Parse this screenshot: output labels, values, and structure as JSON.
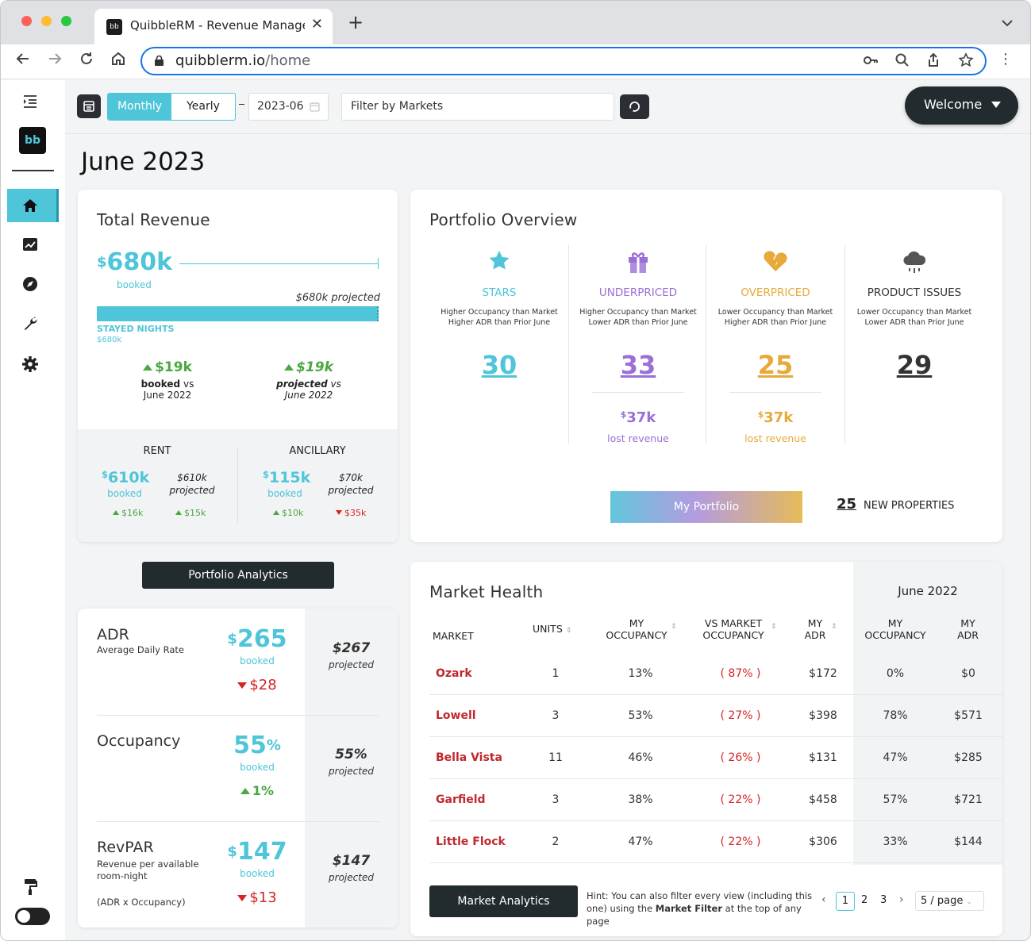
{
  "browser": {
    "tab_title": "QuibbleRM - Revenue Manager",
    "favicon_text": "bb",
    "url_domain": "quibblerm.io",
    "url_path": "/home"
  },
  "topbar": {
    "period_options": [
      "Monthly",
      "Yearly"
    ],
    "selected_period": "Monthly",
    "date_value": "2023-06",
    "market_filter_placeholder": "Filter by Markets",
    "welcome_label": "Welcome"
  },
  "page_title": "June 2023",
  "total_revenue": {
    "title": "Total Revenue",
    "booked_value": "680k",
    "booked_label": "booked",
    "projected_label": "$680k projected",
    "stayed_nights_label": "STAYED NIGHTS",
    "stayed_nights_value": "$680k",
    "progress_fraction": 1.0,
    "vs_booked_value": "$19k",
    "vs_booked_bold": "booked",
    "vs_booked_text": "vs",
    "vs_booked_period": "June 2022",
    "vs_projected_value": "$19k",
    "vs_projected_bold": "projected",
    "vs_projected_text": "vs",
    "vs_projected_period": "June 2022",
    "rent": {
      "label": "RENT",
      "booked": "610k",
      "booked_label": "booked",
      "projected": "$610k",
      "projected_label": "projected",
      "delta_booked": "$16k",
      "delta_projected": "$15k"
    },
    "ancillary": {
      "label": "ANCILLARY",
      "booked": "115k",
      "booked_label": "booked",
      "projected": "$70k",
      "projected_label": "projected",
      "delta_booked": "$10k",
      "delta_projected": "$35k"
    }
  },
  "portfolio_analytics_label": "Portfolio Analytics",
  "kpis": [
    {
      "title": "ADR",
      "subtitle": "Average Daily Rate",
      "extra": "",
      "value": "265",
      "prefix": "$",
      "suffix": "",
      "booked_label": "booked",
      "delta": "$28",
      "direction": "down",
      "projected": "$267",
      "projected_label": "projected"
    },
    {
      "title": "Occupancy",
      "subtitle": "",
      "extra": "",
      "value": "55",
      "prefix": "",
      "suffix": "%",
      "booked_label": "booked",
      "delta": "1%",
      "direction": "up",
      "projected": "55%",
      "projected_label": "projected"
    },
    {
      "title": "RevPAR",
      "subtitle": "Revenue per available room-night",
      "extra": "(ADR x Occupancy)",
      "value": "147",
      "prefix": "$",
      "suffix": "",
      "booked_label": "booked",
      "delta": "$13",
      "direction": "down",
      "projected": "$147",
      "projected_label": "projected"
    }
  ],
  "portfolio_overview": {
    "title": "Portfolio Overview",
    "segments": [
      {
        "key": "stars",
        "label": "STARS",
        "line1": "Higher Occupancy than Market",
        "line2": "Higher ADR than Prior June",
        "count": "30",
        "lost": "",
        "lost_label": "",
        "color": "#4ec5d9",
        "icon": "star-icon"
      },
      {
        "key": "underpriced",
        "label": "UNDERPRICED",
        "line1": "Higher Occupancy than Market",
        "line2": "Lower ADR than Prior June",
        "count": "33",
        "lost": "37k",
        "lost_label": "lost revenue",
        "color": "#9a6fd6",
        "icon": "gift-icon"
      },
      {
        "key": "overpriced",
        "label": "OVERPRICED",
        "line1": "Lower Occupancy than Market",
        "line2": "Higher ADR than Prior June",
        "count": "25",
        "lost": "37k",
        "lost_label": "lost revenue",
        "color": "#e6a93a",
        "icon": "broken-heart-icon"
      },
      {
        "key": "issues",
        "label": "PRODUCT ISSUES",
        "line1": "Lower Occupancy than Market",
        "line2": "Lower ADR than Prior June",
        "count": "29",
        "lost": "",
        "lost_label": "",
        "color": "#333333",
        "icon": "rain-cloud-icon"
      }
    ],
    "my_portfolio_label": "My Portfolio",
    "new_count": "25",
    "new_label": "NEW PROPERTIES"
  },
  "market_health": {
    "title": "Market Health",
    "prior_label": "June 2022",
    "columns": {
      "market": "MARKET",
      "units": "UNITS",
      "my_occ_1": "MY",
      "my_occ_2": "OCCUPANCY",
      "vs_1": "VS MARKET",
      "vs_2": "OCCUPANCY",
      "adr_1": "MY",
      "adr_2": "ADR",
      "prior_occ_1": "MY",
      "prior_occ_2": "OCCUPANCY",
      "prior_adr_1": "MY",
      "prior_adr_2": "ADR"
    },
    "rows": [
      {
        "market": "Ozark",
        "units": "1",
        "occ": "13%",
        "vs": "( 87% )",
        "adr": "$172",
        "p_occ": "0%",
        "p_adr": "$0"
      },
      {
        "market": "Lowell",
        "units": "3",
        "occ": "53%",
        "vs": "( 27% )",
        "adr": "$398",
        "p_occ": "78%",
        "p_adr": "$571"
      },
      {
        "market": "Bella Vista",
        "units": "11",
        "occ": "46%",
        "vs": "( 26% )",
        "adr": "$131",
        "p_occ": "47%",
        "p_adr": "$285"
      },
      {
        "market": "Garfield",
        "units": "3",
        "occ": "38%",
        "vs": "( 22% )",
        "adr": "$458",
        "p_occ": "57%",
        "p_adr": "$721"
      },
      {
        "market": "Little Flock",
        "units": "2",
        "occ": "47%",
        "vs": "( 22% )",
        "adr": "$306",
        "p_occ": "33%",
        "p_adr": "$144"
      }
    ],
    "analytics_label": "Market Analytics",
    "hint_pre": "Hint: You can also filter every view (including this one) using the ",
    "hint_bold": "Market Filter",
    "hint_post": " at the top of any page",
    "pages": [
      "1",
      "2",
      "3"
    ],
    "current_page": "1",
    "page_size": "5 / page"
  },
  "colors": {
    "accent": "#4ec5d9",
    "dark": "#222b2d",
    "green": "#4aa741",
    "red": "#d32525",
    "purple": "#9a6fd6",
    "orange": "#e6a93a"
  }
}
